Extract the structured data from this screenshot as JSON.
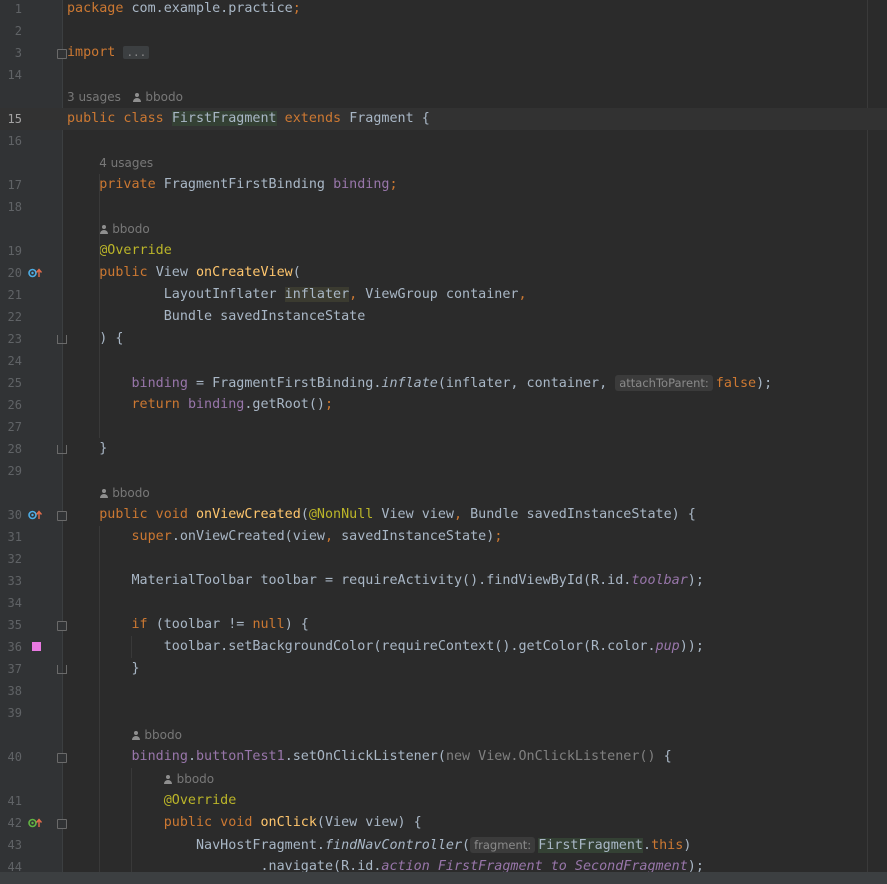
{
  "editor": {
    "lines": [
      {
        "num": "1",
        "parts": [
          [
            "package",
            "kw"
          ],
          [
            " com.example.practice",
            ""
          ],
          [
            ";",
            "kw"
          ]
        ]
      },
      {
        "num": "2",
        "parts": []
      },
      {
        "num": "3",
        "parts": [
          [
            "import",
            "kw"
          ],
          [
            " ",
            ""
          ],
          [
            "...",
            "fold-box"
          ]
        ]
      },
      {
        "num": "14",
        "parts": []
      },
      {
        "hint": true,
        "usages": "3 usages",
        "author": "bbodo"
      },
      {
        "num": "15",
        "current": true,
        "parts": [
          [
            "public class ",
            "kw"
          ],
          [
            "FirstFragment",
            "hl"
          ],
          [
            " extends ",
            "kw"
          ],
          [
            "Fragment {",
            ""
          ]
        ]
      },
      {
        "num": "16",
        "parts": []
      },
      {
        "hint": true,
        "indent": 4,
        "usages": "4 usages"
      },
      {
        "num": "17",
        "parts": [
          [
            "    private ",
            "kw"
          ],
          [
            "FragmentFirstBinding ",
            ""
          ],
          [
            "binding",
            "fld"
          ],
          [
            ";",
            "kw"
          ]
        ]
      },
      {
        "num": "18",
        "parts": []
      },
      {
        "hint": true,
        "indent": 4,
        "author": "bbodo"
      },
      {
        "num": "19",
        "parts": [
          [
            "    @Override",
            "ann"
          ]
        ]
      },
      {
        "num": "20",
        "icon": "override",
        "parts": [
          [
            "    public ",
            "kw"
          ],
          [
            "View ",
            ""
          ],
          [
            "onCreateView",
            "fn"
          ],
          [
            "(",
            ""
          ]
        ]
      },
      {
        "num": "21",
        "parts": [
          [
            "            LayoutInflater ",
            ""
          ],
          [
            "inflater",
            "hl2"
          ],
          [
            ", ",
            "kw"
          ],
          [
            "ViewGroup container",
            ""
          ],
          [
            ",",
            "kw"
          ]
        ]
      },
      {
        "num": "22",
        "parts": [
          [
            "            Bundle savedInstanceState",
            ""
          ]
        ]
      },
      {
        "num": "23",
        "parts": [
          [
            "    ) {",
            ""
          ]
        ]
      },
      {
        "num": "24",
        "parts": []
      },
      {
        "num": "25",
        "parts": [
          [
            "        ",
            ""
          ],
          [
            "binding",
            "fld"
          ],
          [
            " = FragmentFirstBinding.",
            ""
          ],
          [
            "inflate",
            "sm"
          ],
          [
            "(inflater, container, ",
            ""
          ],
          [
            "attachToParent:",
            "param-hint"
          ],
          [
            "false",
            "kw"
          ],
          [
            ");",
            ""
          ]
        ]
      },
      {
        "num": "26",
        "parts": [
          [
            "        return ",
            "kw"
          ],
          [
            "binding",
            "fld"
          ],
          [
            ".getRoot()",
            ""
          ],
          [
            ";",
            "kw"
          ]
        ]
      },
      {
        "num": "27",
        "parts": []
      },
      {
        "num": "28",
        "parts": [
          [
            "    }",
            ""
          ]
        ]
      },
      {
        "num": "29",
        "parts": []
      },
      {
        "hint": true,
        "indent": 4,
        "author": "bbodo"
      },
      {
        "num": "30",
        "icon": "override",
        "parts": [
          [
            "    public void ",
            "kw"
          ],
          [
            "onViewCreated",
            "fn"
          ],
          [
            "(",
            ""
          ],
          [
            "@NonNull",
            "ann"
          ],
          [
            " View view",
            ""
          ],
          [
            ", ",
            "kw"
          ],
          [
            "Bundle savedInstanceState) {",
            ""
          ]
        ]
      },
      {
        "num": "31",
        "parts": [
          [
            "        super",
            "kw"
          ],
          [
            ".onViewCreated(view",
            ""
          ],
          [
            ", ",
            "kw"
          ],
          [
            "savedInstanceState)",
            ""
          ],
          [
            ";",
            "kw"
          ]
        ]
      },
      {
        "num": "32",
        "parts": []
      },
      {
        "num": "33",
        "parts": [
          [
            "        MaterialToolbar toolbar = requireActivity().findViewById(R.id.",
            ""
          ],
          [
            "toolbar",
            "ifld"
          ],
          [
            ");",
            ""
          ]
        ]
      },
      {
        "num": "34",
        "parts": []
      },
      {
        "num": "35",
        "parts": [
          [
            "        if ",
            "kw"
          ],
          [
            "(toolbar != ",
            ""
          ],
          [
            "null",
            "kw"
          ],
          [
            ") {",
            ""
          ]
        ]
      },
      {
        "num": "36",
        "icon": "color",
        "parts": [
          [
            "            toolbar.setBackgroundColor(requireContext().getColor(R.color.",
            ""
          ],
          [
            "pup",
            "ifld"
          ],
          [
            "));",
            ""
          ]
        ]
      },
      {
        "num": "37",
        "parts": [
          [
            "        }",
            ""
          ]
        ]
      },
      {
        "num": "38",
        "parts": []
      },
      {
        "num": "39",
        "parts": []
      },
      {
        "hint": true,
        "indent": 8,
        "author": "bbodo"
      },
      {
        "num": "40",
        "parts": [
          [
            "        ",
            ""
          ],
          [
            "binding",
            "fld"
          ],
          [
            ".",
            ""
          ],
          [
            "buttonTest1",
            "fld"
          ],
          [
            ".setOnClickListener(",
            ""
          ],
          [
            "new View.OnClickListener() ",
            "sec"
          ],
          [
            "{",
            ""
          ]
        ]
      },
      {
        "hint": true,
        "indent": 12,
        "author": "bbodo"
      },
      {
        "num": "41",
        "parts": [
          [
            "            @Override",
            "ann"
          ]
        ]
      },
      {
        "num": "42",
        "icon": "impl",
        "parts": [
          [
            "            public void ",
            "kw"
          ],
          [
            "onClick",
            "fn"
          ],
          [
            "(View view) {",
            ""
          ]
        ]
      },
      {
        "num": "43",
        "parts": [
          [
            "                NavHostFragment.",
            ""
          ],
          [
            "findNavController",
            "sm"
          ],
          [
            "(",
            ""
          ],
          [
            "fragment:",
            "param-hint"
          ],
          [
            "FirstFragment",
            "hl"
          ],
          [
            ".",
            ""
          ],
          [
            "this",
            "kw"
          ],
          [
            ")",
            ""
          ]
        ]
      },
      {
        "num": "44",
        "parts": [
          [
            "                        .navigate(R.id.",
            ""
          ],
          [
            "action_FirstFragment_to_SecondFragment",
            "ifld"
          ],
          [
            ");",
            ""
          ]
        ]
      }
    ]
  },
  "colors": {
    "background": "#2b2b2b",
    "keyword": "#cc7832",
    "method": "#ffc66d",
    "annotation": "#bbb529",
    "field": "#9876aa",
    "text": "#a9b7c6",
    "swatch_pup": "#e879e0"
  },
  "icons": {
    "override": "override-method-icon",
    "impl": "implements-method-icon",
    "color": "color-swatch-icon"
  }
}
